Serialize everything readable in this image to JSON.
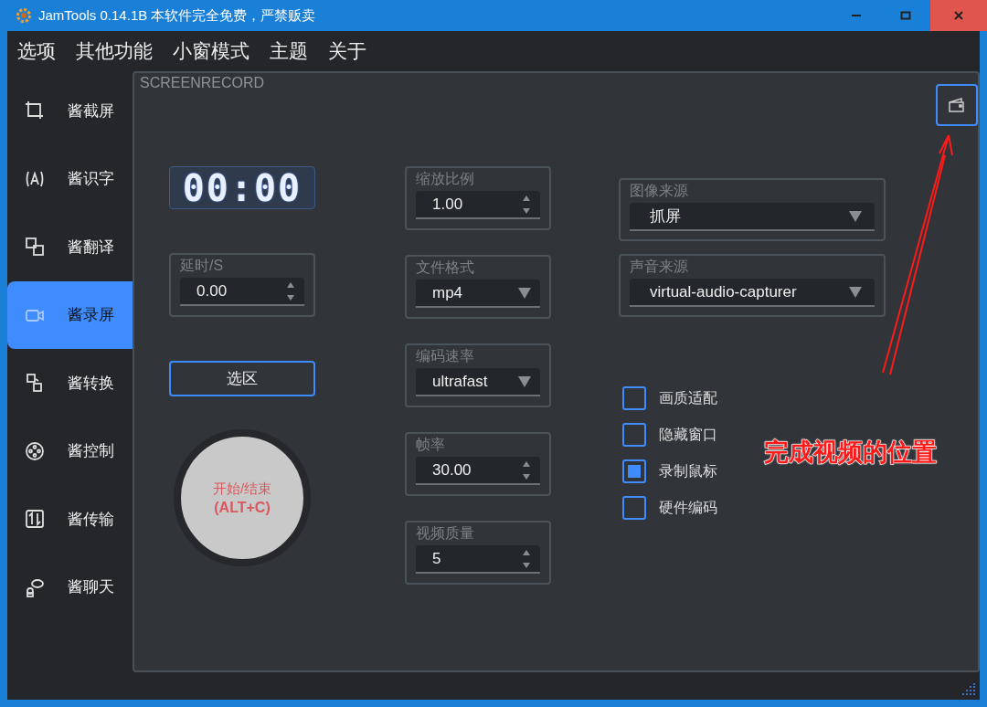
{
  "window": {
    "title": "JamTools 0.14.1B 本软件完全免费，严禁贩卖"
  },
  "menu": [
    "选项",
    "其他功能",
    "小窗模式",
    "主题",
    "关于"
  ],
  "sidebar": {
    "items": [
      {
        "label": "酱截屏",
        "selected": false
      },
      {
        "label": "酱识字",
        "selected": false
      },
      {
        "label": "酱翻译",
        "selected": false
      },
      {
        "label": "酱录屏",
        "selected": true
      },
      {
        "label": "酱转换",
        "selected": false
      },
      {
        "label": "酱控制",
        "selected": false
      },
      {
        "label": "酱传输",
        "selected": false
      },
      {
        "label": "酱聊天",
        "selected": false
      }
    ]
  },
  "panel": {
    "title": "SCREENRECORD",
    "timer": "00:00",
    "delay": {
      "label": "延时/S",
      "value": "0.00"
    },
    "select_button": "选区",
    "record_button": [
      "开始/结束",
      "(ALT+C)"
    ],
    "settings": [
      {
        "kind": "spinbox",
        "label": "缩放比例",
        "value": "1.00"
      },
      {
        "kind": "dropdown",
        "label": "文件格式",
        "value": "mp4"
      },
      {
        "kind": "dropdown",
        "label": "编码速率",
        "value": "ultrafast"
      },
      {
        "kind": "spinbox",
        "label": "帧率",
        "value": "30.00"
      },
      {
        "kind": "spinbox",
        "label": "视频质量",
        "value": "5"
      }
    ],
    "sources": [
      {
        "kind": "dropdown",
        "label": "图像来源",
        "value": "抓屏"
      },
      {
        "kind": "dropdown",
        "label": "声音来源",
        "value": "virtual-audio-capturer"
      }
    ],
    "checkboxes": [
      {
        "label": "画质适配",
        "checked": false
      },
      {
        "label": "隐藏窗口",
        "checked": false
      },
      {
        "label": "录制鼠标",
        "checked": true
      },
      {
        "label": "硬件编码",
        "checked": false
      }
    ]
  },
  "annotation": {
    "text": "完成视频的位置"
  }
}
